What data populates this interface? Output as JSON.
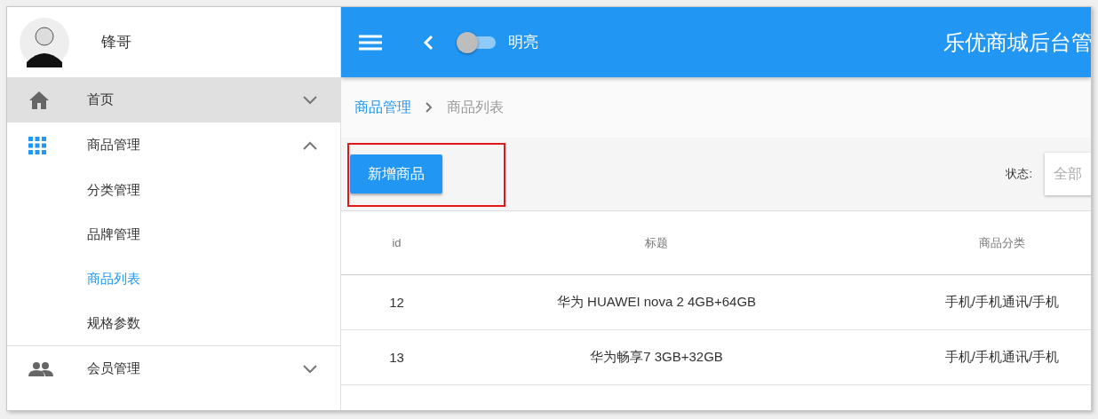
{
  "sidebar": {
    "user": {
      "name": "锋哥"
    },
    "items": [
      {
        "label": "首页",
        "selected": true,
        "expanded": false
      },
      {
        "label": "商品管理",
        "selected": false,
        "expanded": true,
        "children": [
          {
            "label": "分类管理",
            "selected": false
          },
          {
            "label": "品牌管理",
            "selected": false
          },
          {
            "label": "商品列表",
            "selected": true
          },
          {
            "label": "规格参数",
            "selected": false
          }
        ]
      },
      {
        "label": "会员管理",
        "selected": false,
        "expanded": false
      }
    ]
  },
  "header": {
    "theme_switch": {
      "label": "明亮",
      "on": false
    },
    "title": "乐优商城后台管"
  },
  "breadcrumb": [
    {
      "label": "商品管理",
      "link": true
    },
    {
      "label": "商品列表",
      "link": false
    }
  ],
  "toolbar": {
    "add_button": "新增商品",
    "status_label": "状态:",
    "status_select": {
      "placeholder": "全部"
    }
  },
  "table": {
    "columns": [
      "id",
      "标题",
      "商品分类"
    ],
    "rows": [
      [
        "12",
        "华为 HUAWEI nova 2 4GB+64GB",
        "手机/手机通讯/手机"
      ],
      [
        "13",
        "华为畅享7 3GB+32GB",
        "手机/手机通讯/手机"
      ]
    ]
  }
}
